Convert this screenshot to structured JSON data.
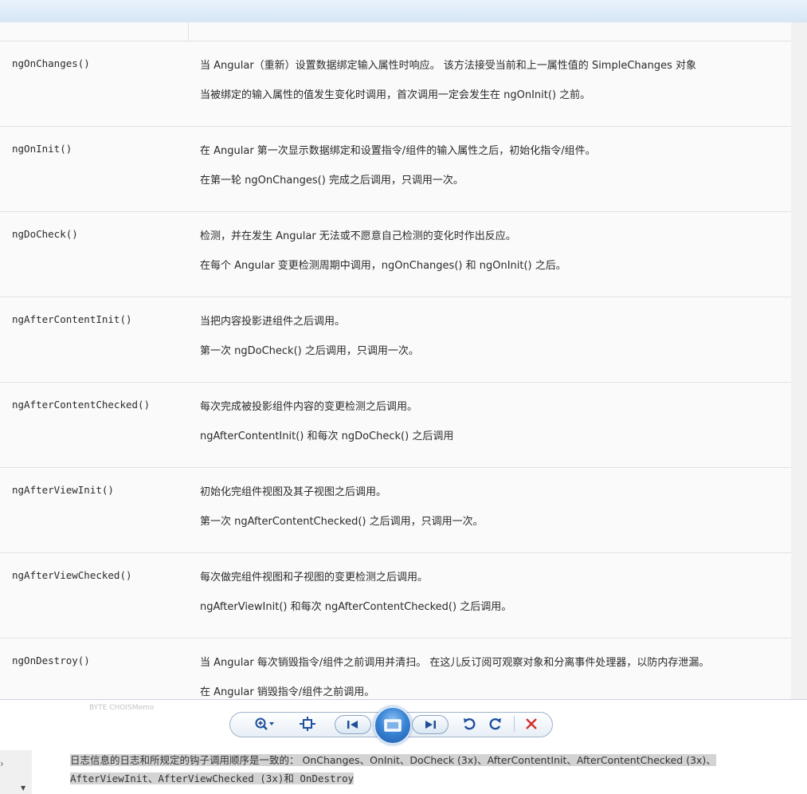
{
  "rows": [
    {
      "hook": "ngOnChanges()",
      "line1": "当 Angular（重新）设置数据绑定输入属性时响应。 该方法接受当前和上一属性值的 SimpleChanges 对象",
      "line2": "当被绑定的输入属性的值发生变化时调用，首次调用一定会发生在 ngOnInit() 之前。"
    },
    {
      "hook": "ngOnInit()",
      "line1": "在 Angular 第一次显示数据绑定和设置指令/组件的输入属性之后，初始化指令/组件。",
      "line2": "在第一轮 ngOnChanges() 完成之后调用，只调用一次。"
    },
    {
      "hook": "ngDoCheck()",
      "line1": "检测，并在发生 Angular 无法或不愿意自己检测的变化时作出反应。",
      "line2": "在每个 Angular 变更检测周期中调用，ngOnChanges() 和 ngOnInit() 之后。"
    },
    {
      "hook": "ngAfterContentInit()",
      "line1": "当把内容投影进组件之后调用。",
      "line2": "第一次 ngDoCheck() 之后调用，只调用一次。"
    },
    {
      "hook": "ngAfterContentChecked()",
      "line1": "每次完成被投影组件内容的变更检测之后调用。",
      "line2": "ngAfterContentInit() 和每次 ngDoCheck() 之后调用"
    },
    {
      "hook": "ngAfterViewInit()",
      "line1": "初始化完组件视图及其子视图之后调用。",
      "line2": "第一次 ngAfterContentChecked() 之后调用，只调用一次。"
    },
    {
      "hook": "ngAfterViewChecked()",
      "line1": "每次做完组件视图和子视图的变更检测之后调用。",
      "line2": "ngAfterViewInit() 和每次 ngAfterContentChecked() 之后调用。"
    },
    {
      "hook": "ngOnDestroy()",
      "line1": "当 Angular 每次销毁指令/组件之前调用并清扫。 在这儿反订阅可观察对象和分离事件处理器，以防内存泄漏。",
      "line2": "在 Angular 销毁指令/组件之前调用。"
    }
  ],
  "viewer": {
    "background_text": "BYTE CHOISMemo",
    "icons": {
      "zoom": "zoom-in-icon",
      "fit": "actual-size-icon",
      "prev": "previous-icon",
      "slideshow": "slideshow-icon",
      "next": "next-icon",
      "rotate_ccw": "rotate-counterclockwise-icon",
      "rotate_cw": "rotate-clockwise-icon",
      "delete": "delete-icon"
    },
    "accent": "#1e4f9e",
    "delete_color": "#d0312d"
  },
  "footer": {
    "line1": "日志信息的日志和所规定的钩子调用顺序是一致的： OnChanges、OnInit、DoCheck (3x)、AfterContentInit、AfterContentChecked (3x)、",
    "line2": "AfterViewInit、AfterViewChecked (3x)和 OnDestroy"
  }
}
